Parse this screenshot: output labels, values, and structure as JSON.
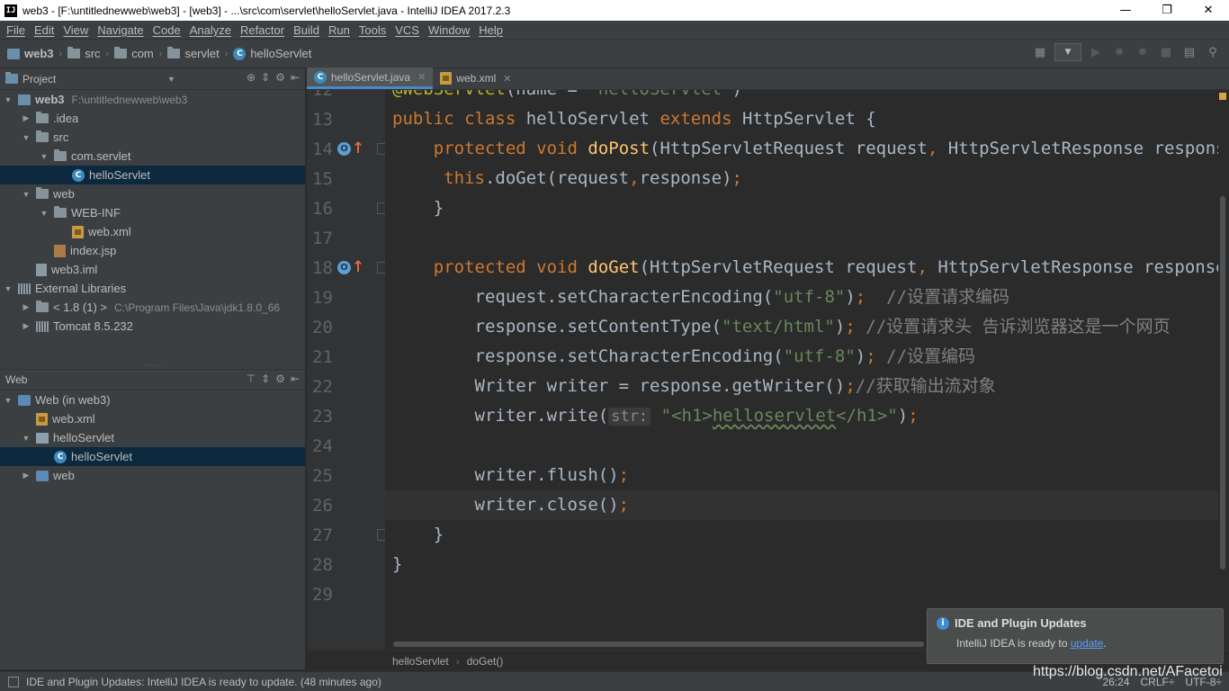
{
  "window": {
    "title": "web3 - [F:\\untitlednewweb\\web3] - [web3] - ...\\src\\com\\servlet\\helloServlet.java - IntelliJ IDEA 2017.2.3",
    "app_icon": "IJ",
    "minimize": "—",
    "restore": "❐",
    "close": "✕"
  },
  "menu": [
    "File",
    "Edit",
    "View",
    "Navigate",
    "Code",
    "Analyze",
    "Refactor",
    "Build",
    "Run",
    "Tools",
    "VCS",
    "Window",
    "Help"
  ],
  "breadcrumb": [
    "web3",
    "src",
    "com",
    "servlet",
    "helloServlet"
  ],
  "project_panel": {
    "title": "Project",
    "tree": [
      {
        "label": "web3",
        "extra": "F:\\untitlednewweb\\web3",
        "indent": 0,
        "arrow": "▼",
        "icon": "module-icon",
        "bold": true
      },
      {
        "label": ".idea",
        "indent": 1,
        "arrow": "▶",
        "icon": "folder-icon"
      },
      {
        "label": "src",
        "indent": 1,
        "arrow": "▼",
        "icon": "folder-icon"
      },
      {
        "label": "com.servlet",
        "indent": 2,
        "arrow": "▼",
        "icon": "folder-icon"
      },
      {
        "label": "helloServlet",
        "indent": 3,
        "arrow": "",
        "icon": "class-icon",
        "selected": true
      },
      {
        "label": "web",
        "indent": 1,
        "arrow": "▼",
        "icon": "folder-icon"
      },
      {
        "label": "WEB-INF",
        "indent": 2,
        "arrow": "▼",
        "icon": "folder-icon"
      },
      {
        "label": "web.xml",
        "indent": 3,
        "arrow": "",
        "icon": "xml-icon"
      },
      {
        "label": "index.jsp",
        "indent": 2,
        "arrow": "",
        "icon": "jsp-icon"
      },
      {
        "label": "web3.iml",
        "indent": 1,
        "arrow": "",
        "icon": "iml-icon"
      },
      {
        "label": "External Libraries",
        "indent": 0,
        "arrow": "▼",
        "icon": "library-icon"
      },
      {
        "label": "< 1.8 (1) >",
        "extra": "C:\\Program Files\\Java\\jdk1.8.0_66",
        "indent": 1,
        "arrow": "▶",
        "icon": "folder-icon"
      },
      {
        "label": "Tomcat 8.5.232",
        "indent": 1,
        "arrow": "▶",
        "icon": "library-icon"
      }
    ]
  },
  "web_panel": {
    "title": "Web",
    "tree": [
      {
        "label": "Web (in web3)",
        "indent": 0,
        "arrow": "▼",
        "icon": "web-icon"
      },
      {
        "label": "web.xml",
        "indent": 1,
        "arrow": "",
        "icon": "xml-icon"
      },
      {
        "label": "helloServlet",
        "indent": 1,
        "arrow": "▼",
        "icon": "servlet-icon"
      },
      {
        "label": "helloServlet",
        "indent": 2,
        "arrow": "",
        "icon": "class-icon",
        "selected": true
      },
      {
        "label": "web",
        "indent": 1,
        "arrow": "▶",
        "icon": "web-icon"
      }
    ]
  },
  "editor_tabs": [
    {
      "label": "helloServlet.java",
      "icon": "class-icon",
      "active": true
    },
    {
      "label": "web.xml",
      "icon": "xml-icon",
      "active": false
    }
  ],
  "code_lines": [
    {
      "num": "12",
      "html": "<span class=\"ann\">@WebServlet</span>(name = <span class=\"str\">\"helloServlet\"</span>)"
    },
    {
      "num": "13",
      "html": "<span class=\"kw\">public class</span> helloServlet <span class=\"kw\">extends</span> HttpServlet {"
    },
    {
      "num": "14",
      "html": "    <span class=\"kw\">protected void</span> <span class=\"fn\">doPost</span>(HttpServletRequest request<span class=\"kw\">,</span> HttpServletResponse response) <span class=\"kw\">throws</span>",
      "override": true
    },
    {
      "num": "15",
      "html": "     <span class=\"kw\">this</span>.doGet(request<span class=\"kw\">,</span>response)<span class=\"kw\">;</span>"
    },
    {
      "num": "16",
      "html": "    }"
    },
    {
      "num": "17",
      "html": ""
    },
    {
      "num": "18",
      "html": "    <span class=\"kw\">protected void</span> <span class=\"fn\">doGet</span>(HttpServletRequest request<span class=\"kw\">,</span> HttpServletResponse response) <span class=\"kw\">th</span>",
      "override": true
    },
    {
      "num": "19",
      "html": "        request.setCharacterEncoding(<span class=\"str\">\"utf-8\"</span>)<span class=\"kw\">;</span>  <span class=\"cmt\">//设置请求编码</span>"
    },
    {
      "num": "20",
      "html": "        response.setContentType(<span class=\"str\">\"text/html\"</span>)<span class=\"kw\">;</span> <span class=\"cmt\">//设置请求头 告诉浏览器这是一个网页</span>"
    },
    {
      "num": "21",
      "html": "        response.setCharacterEncoding(<span class=\"str\">\"utf-8\"</span>)<span class=\"kw\">;</span> <span class=\"cmt\">//设置编码</span>"
    },
    {
      "num": "22",
      "html": "        Writer writer = response.getWriter()<span class=\"kw\">;</span><span class=\"cmt\">//获取输出流对象</span>"
    },
    {
      "num": "23",
      "html": "        writer.write(<span class=\"hint\">str:</span> <span class=\"str\">\"&lt;h1&gt;<span class=\"squig\">helloservlet</span>&lt;/h1&gt;\"</span>)<span class=\"kw\">;</span>"
    },
    {
      "num": "24",
      "html": ""
    },
    {
      "num": "25",
      "html": "        writer.flush()<span class=\"kw\">;</span>"
    },
    {
      "num": "26",
      "html": "        writer.close()<span class=\"kw\">;</span>",
      "caret": true
    },
    {
      "num": "27",
      "html": "    }"
    },
    {
      "num": "28",
      "html": "}"
    },
    {
      "num": "29",
      "html": ""
    }
  ],
  "code_breadcrumb": [
    "helloServlet",
    "doGet()"
  ],
  "notification": {
    "title": "IDE and Plugin Updates",
    "body_prefix": "IntelliJ IDEA is ready to ",
    "link": "update",
    "body_suffix": "."
  },
  "status": {
    "message": "IDE and Plugin Updates: IntelliJ IDEA is ready to update. (48 minutes ago)",
    "position": "26:24",
    "line_sep": "CRLF÷",
    "encoding": "UTF-8÷"
  },
  "watermark": "https://blog.csdn.net/AFacetoi"
}
